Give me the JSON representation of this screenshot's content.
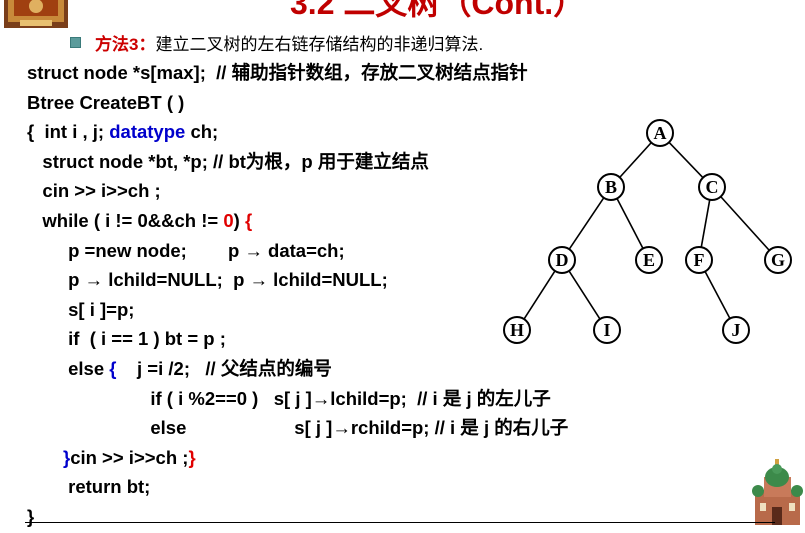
{
  "header": {
    "title": "3.2 二叉树（Cont.）"
  },
  "bullet": {
    "prefix": "方法3：",
    "text": "建立二叉树的左右链存储结构的非递归算法."
  },
  "code": [
    {
      "segments": [
        {
          "t": "struct node *s[max];  // 辅助指针数组，存放二叉树结点指针"
        }
      ]
    },
    {
      "segments": [
        {
          "t": "Btree CreateBT ( )"
        }
      ]
    },
    {
      "segments": [
        {
          "t": "{  int i , j; "
        },
        {
          "t": "datatype",
          "c": "blue"
        },
        {
          "t": " ch;"
        }
      ]
    },
    {
      "segments": [
        {
          "t": "   struct node *bt, *p; // bt为根，p 用于建立结点"
        }
      ]
    },
    {
      "segments": [
        {
          "t": "   cin >> i>>ch ;"
        }
      ]
    },
    {
      "segments": [
        {
          "t": "   while ( i != 0&&ch != "
        },
        {
          "t": "0",
          "c": "red"
        },
        {
          "t": ") "
        },
        {
          "t": "{",
          "c": "red"
        }
      ]
    },
    {
      "segments": [
        {
          "t": "        p =new node;        p → data=ch;"
        }
      ]
    },
    {
      "segments": [
        {
          "t": "        p → lchild=NULL;  p → lchild=NULL;"
        }
      ]
    },
    {
      "segments": [
        {
          "t": "        s[ i ]=p;"
        }
      ]
    },
    {
      "segments": [
        {
          "t": "        if  ( i == 1 ) bt = p ;"
        }
      ]
    },
    {
      "segments": [
        {
          "t": "        else "
        },
        {
          "t": "{",
          "c": "blue"
        },
        {
          "t": "    j =i /2;   // 父结点的编号"
        }
      ]
    },
    {
      "segments": [
        {
          "t": "                        if ( i %2==0 )   s[ j ]→lchild=p;  // i 是 j 的左儿子"
        }
      ]
    },
    {
      "segments": [
        {
          "t": "                        else                     s[ j ]→rchild=p; // i 是 j 的右儿子"
        }
      ]
    },
    {
      "segments": [
        {
          "t": "       "
        },
        {
          "t": "}",
          "c": "blue"
        },
        {
          "t": "cin >> i>>ch ;"
        },
        {
          "t": "}",
          "c": "red"
        }
      ]
    },
    {
      "segments": [
        {
          "t": "        return bt;"
        }
      ]
    },
    {
      "segments": [
        {
          "t": "}"
        }
      ]
    }
  ],
  "tree": {
    "nodes": [
      {
        "id": "A",
        "label": "A"
      },
      {
        "id": "B",
        "label": "B"
      },
      {
        "id": "C",
        "label": "C"
      },
      {
        "id": "D",
        "label": "D"
      },
      {
        "id": "E",
        "label": "E"
      },
      {
        "id": "F",
        "label": "F"
      },
      {
        "id": "G",
        "label": "G"
      },
      {
        "id": "H",
        "label": "H"
      },
      {
        "id": "I",
        "label": "I"
      },
      {
        "id": "J",
        "label": "J"
      }
    ],
    "edges": [
      [
        "A",
        "B"
      ],
      [
        "A",
        "C"
      ],
      [
        "B",
        "D"
      ],
      [
        "B",
        "E"
      ],
      [
        "C",
        "F"
      ],
      [
        "C",
        "G"
      ],
      [
        "D",
        "H"
      ],
      [
        "D",
        "I"
      ],
      [
        "F",
        "J"
      ]
    ]
  }
}
